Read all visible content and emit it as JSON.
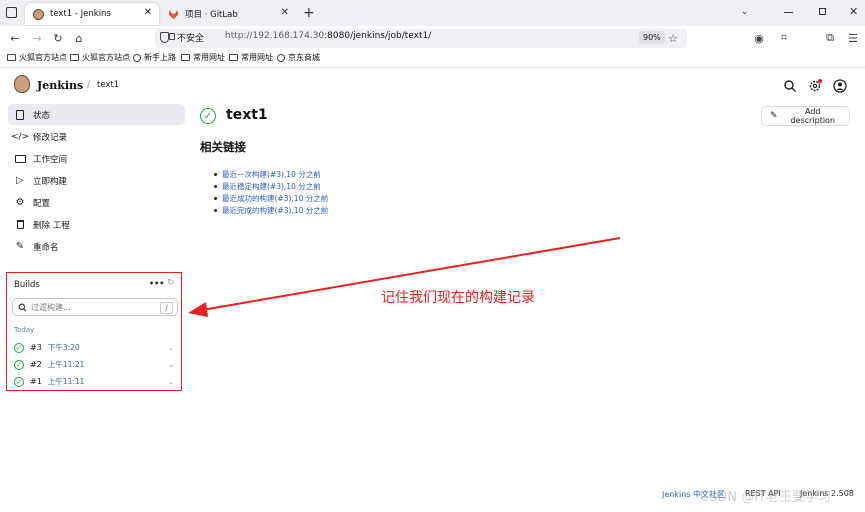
{
  "browser": {
    "tabs": [
      {
        "label": "text1 - Jenkins",
        "active": true
      },
      {
        "label": "项目 · GitLab",
        "active": false
      }
    ],
    "new_tab": "+",
    "insecure_label": "不安全",
    "url_host": "http://192.168.174.30",
    "url_rest": ":8080/jenkins/job/text1/",
    "zoom": "90%",
    "bookmarks": [
      "火狐官方站点",
      "火狐官方站点",
      "新手上路",
      "常用网址",
      "常用网址",
      "京东商城"
    ]
  },
  "jenkins": {
    "brand": "Jenkins",
    "crumb_sep": "/",
    "crumb": "text1",
    "sidebar": [
      {
        "label": "状态",
        "icon": "status-icon",
        "active": true
      },
      {
        "label": "修改记录",
        "icon": "code-icon"
      },
      {
        "label": "工作空间",
        "icon": "folder-icon"
      },
      {
        "label": "立即构建",
        "icon": "play-icon"
      },
      {
        "label": "配置",
        "icon": "gear-icon"
      },
      {
        "label": "删除 工程",
        "icon": "trash-icon"
      },
      {
        "label": "重命名",
        "icon": "pencil-icon"
      }
    ],
    "builds": {
      "title": "Builds",
      "more": "•••",
      "filter_placeholder": "过滤构建...",
      "filter_key": "/",
      "group": "Today",
      "items": [
        {
          "num": "#3",
          "time": "下午3:20"
        },
        {
          "num": "#2",
          "time": "上午11:21"
        },
        {
          "num": "#1",
          "time": "上午11:11"
        }
      ]
    },
    "main": {
      "title": "text1",
      "add_description": "Add description",
      "links_heading": "相关链接",
      "links": [
        "最近一次构建(#3),10 分之前",
        "最近稳定构建(#3),10 分之前",
        "最近成功的构建(#3),10 分之前",
        "最近完成的构建(#3),10 分之前"
      ]
    },
    "annotation": "记住我们现在的构建记录",
    "footer": {
      "community": "Jenkins 中文社区",
      "rest_api": "REST API",
      "version": "Jenkins 2.508",
      "watermark": "CSDN @IT老王要学习"
    }
  },
  "colors": {
    "ok_green": "#1ea446",
    "link_blue": "#2a5bc6",
    "annotation_red": "#e8201e"
  }
}
